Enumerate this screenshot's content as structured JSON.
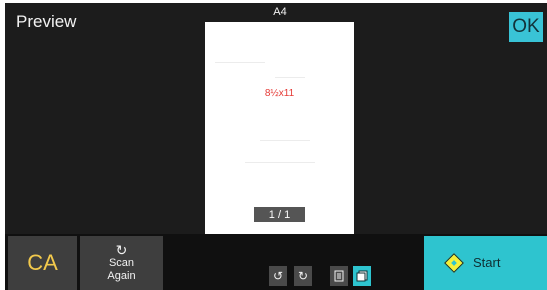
{
  "header": {
    "title": "Preview",
    "ok_label": "OK",
    "paper_size_label": "A4"
  },
  "preview": {
    "size_text": "8½x11",
    "page_counter": "1 / 1"
  },
  "footer": {
    "ca_label": "CA",
    "scan_again_label": "Scan Again",
    "start_label": "Start"
  },
  "icons": {
    "rotate_left": "rotate-left-icon",
    "rotate_right": "rotate-right-icon",
    "single_page": "single-page-icon",
    "multi_page": "multi-page-icon",
    "refresh": "refresh-icon",
    "start": "start-diamond-icon"
  },
  "colors": {
    "ok_button": "#39c3d6",
    "start_button": "#2ec4cf",
    "ca_text": "#f2c94c",
    "size_text": "#e53935"
  }
}
